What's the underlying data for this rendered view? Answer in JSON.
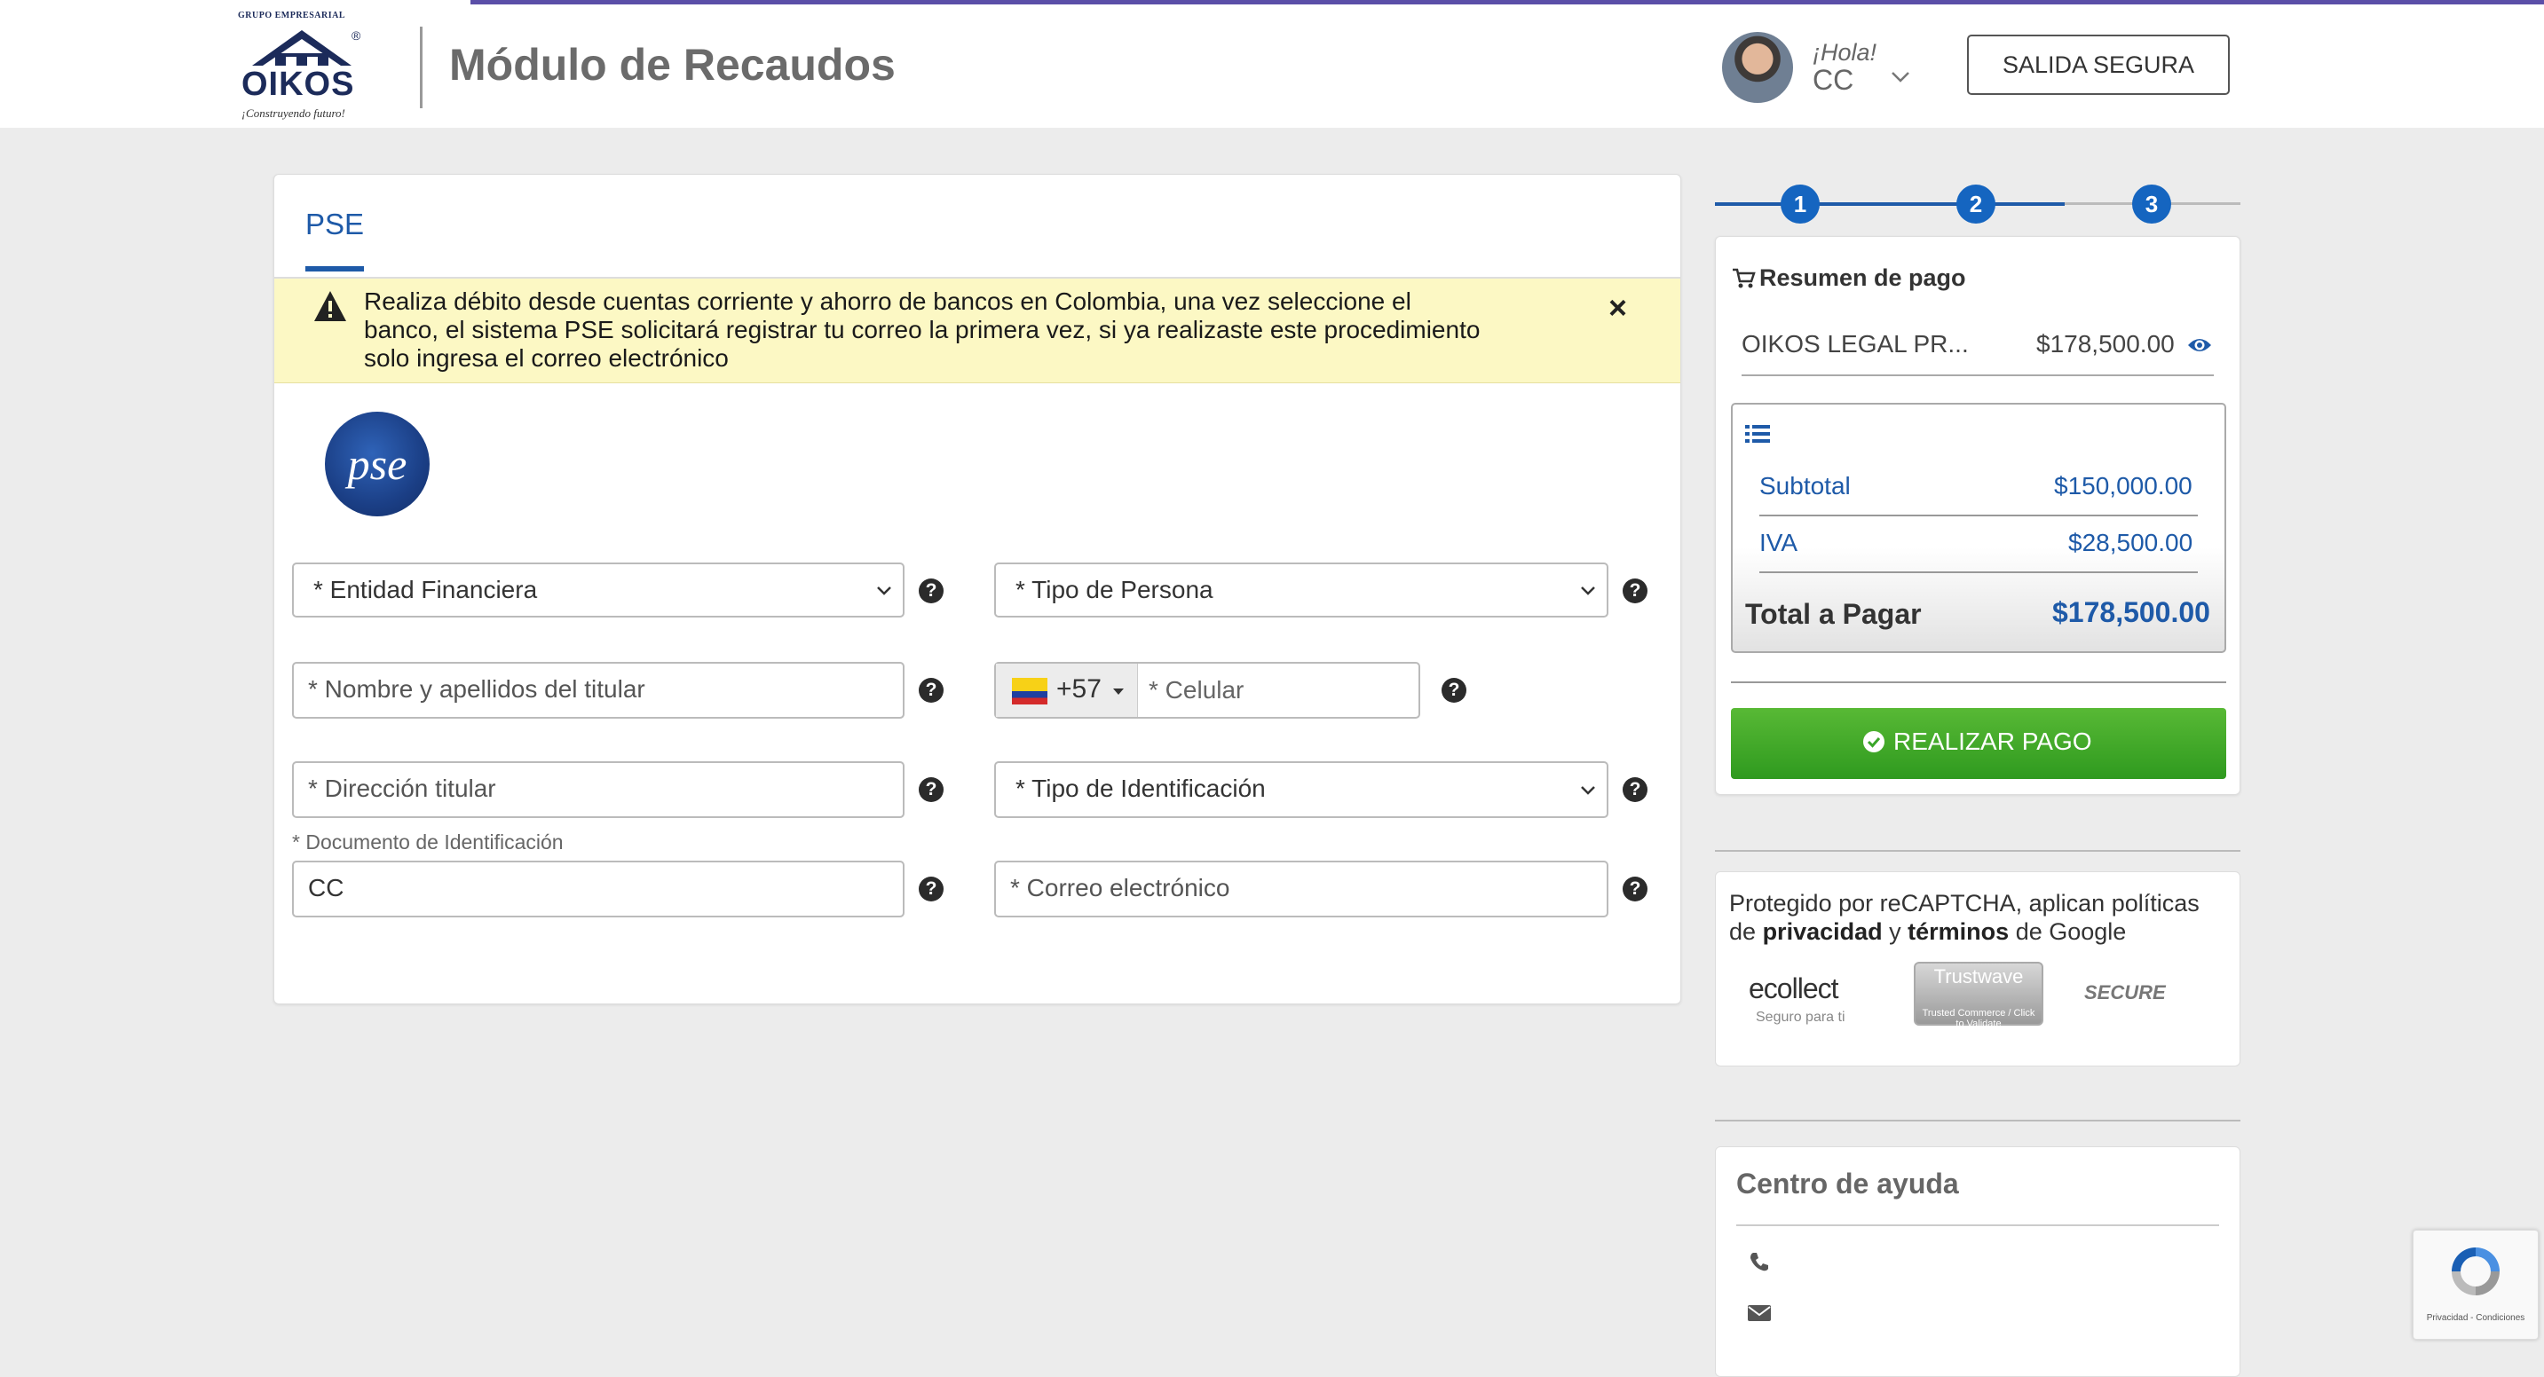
{
  "header": {
    "brand_top": "GRUPO EMPRESARIAL",
    "brand_name": "OIKOS",
    "brand_registered": "®",
    "brand_tagline": "¡Construyendo futuro!",
    "title": "Módulo de Recaudos",
    "greeting": "¡Hola!",
    "user_name": "CC",
    "logout_label": "SALIDA SEGURA"
  },
  "tabs": [
    {
      "label": "PSE"
    }
  ],
  "alert": {
    "text": "Realiza débito desde cuentas corriente y ahorro de bancos en Colombia, una vez seleccione el banco, el sistema PSE solicitará registrar tu correo la primera vez, si ya realizaste este procedimiento solo ingresa el correo electrónico",
    "close_label": "×"
  },
  "pse_logo_text": "pse",
  "form": {
    "entidad_placeholder": "* Entidad Financiera",
    "tipo_persona_placeholder": "* Tipo de Persona",
    "nombre_placeholder": "* Nombre y apellidos del titular",
    "phone_code": "+57",
    "celular_placeholder": "* Celular",
    "direccion_placeholder": "* Dirección titular",
    "tipo_id_placeholder": "* Tipo de Identificación",
    "documento_label": "* Documento de Identificación",
    "documento_value": "CC",
    "correo_placeholder": "* Correo electrónico",
    "help_glyph": "?"
  },
  "steps": [
    "1",
    "2",
    "3"
  ],
  "summary": {
    "title": "Resumen de pago",
    "product_name": "OIKOS LEGAL PR...",
    "product_price": "$178,500.00",
    "subtotal_label": "Subtotal",
    "subtotal_value": "$150,000.00",
    "iva_label": "IVA",
    "iva_value": "$28,500.00",
    "total_label": "Total a Pagar",
    "total_value": "$178,500.00",
    "pay_label": "REALIZAR PAGO"
  },
  "captcha": {
    "line1": "Protegido por reCAPTCHA, aplican políticas",
    "line2_de": "de",
    "privacidad": "privacidad",
    "y": "y",
    "terminos": "términos",
    "de_google": "de Google",
    "ecollect": "ecollect",
    "ecollect_sub": "Seguro para ti",
    "trustwave": "Trustwave",
    "trustwave_sub": "Trusted Commerce / Click to Validate",
    "secure": "SECURE"
  },
  "help_center": {
    "title": "Centro de ayuda"
  },
  "recaptcha_badge": {
    "text": "Privacidad - Condiciones"
  },
  "colors": {
    "accent_blue": "#1e5aa8",
    "pay_green": "#3aa62a",
    "alert_yellow": "#fcf8c4",
    "step_blue": "#1565c0"
  },
  "icons": [
    "warning-icon",
    "close-icon",
    "help-icon",
    "cart-icon",
    "eye-icon",
    "list-icon",
    "check-circle-icon",
    "phone-icon",
    "mail-icon",
    "chevron-down-icon"
  ]
}
